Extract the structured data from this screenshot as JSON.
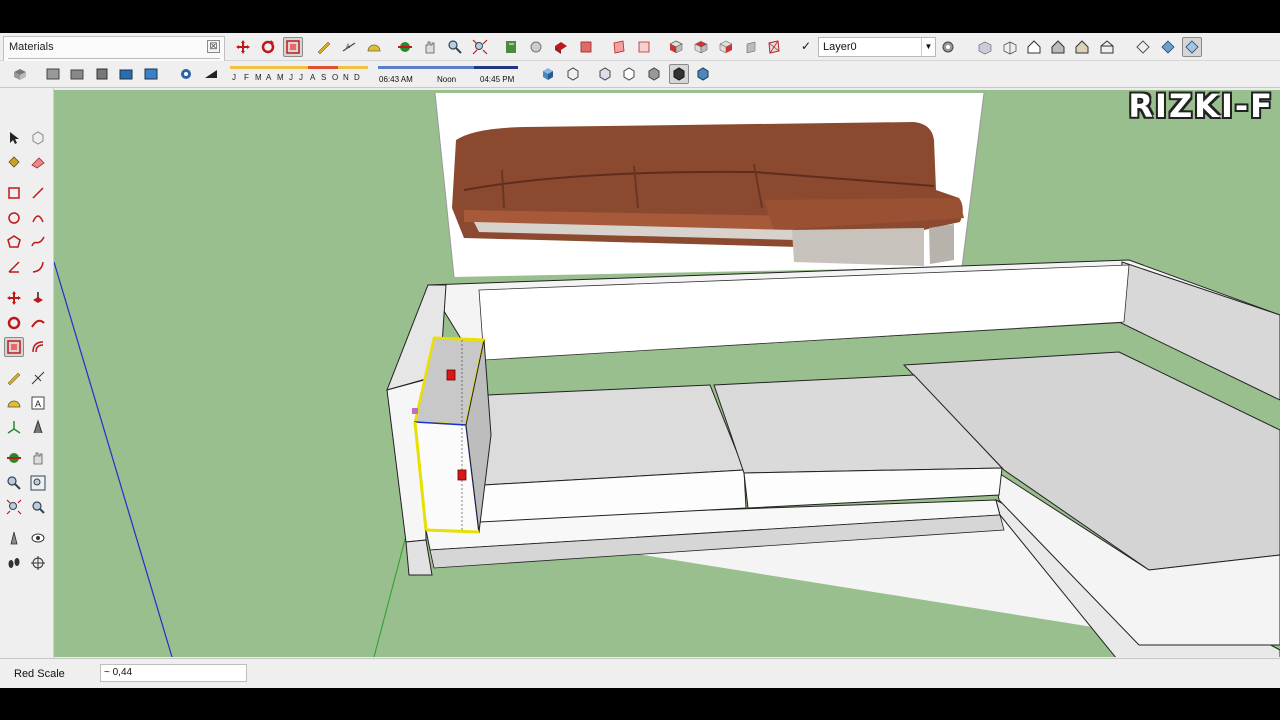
{
  "materials_panel": {
    "title": "Materials",
    "close": "⊠"
  },
  "layer": {
    "check": "✓",
    "name": "Layer0",
    "arrow": "▼"
  },
  "shadows": {
    "months": [
      "J",
      "F",
      "M",
      "A",
      "M",
      "J",
      "J",
      "A",
      "S",
      "O",
      "N",
      "D"
    ],
    "time_start": "06:43 AM",
    "time_noon": "Noon",
    "time_end": "04:45 PM"
  },
  "watermark": "RIZKI-F",
  "status": {
    "vcb_label": "Red Scale",
    "vcb_value": "~ 0,44"
  },
  "left_tools": [
    "select",
    "make-component",
    "paint-bucket",
    "eraser",
    "rectangle",
    "line",
    "circle",
    "arc",
    "polygon",
    "freehand",
    "move",
    "push-pull",
    "rotate",
    "follow-me",
    "scale",
    "offset",
    "tape-measure",
    "dimension",
    "protractor",
    "text",
    "axes",
    "3d-text",
    "orbit",
    "pan",
    "zoom",
    "zoom-window",
    "zoom-extents",
    "previous",
    "position-camera",
    "look-around",
    "walk",
    "section-plane"
  ],
  "colors": {
    "ground": "#98bf8d",
    "selection": "#e8e000",
    "selection_blue": "#1f2fd0",
    "photo_leather": "#8b4a30"
  }
}
